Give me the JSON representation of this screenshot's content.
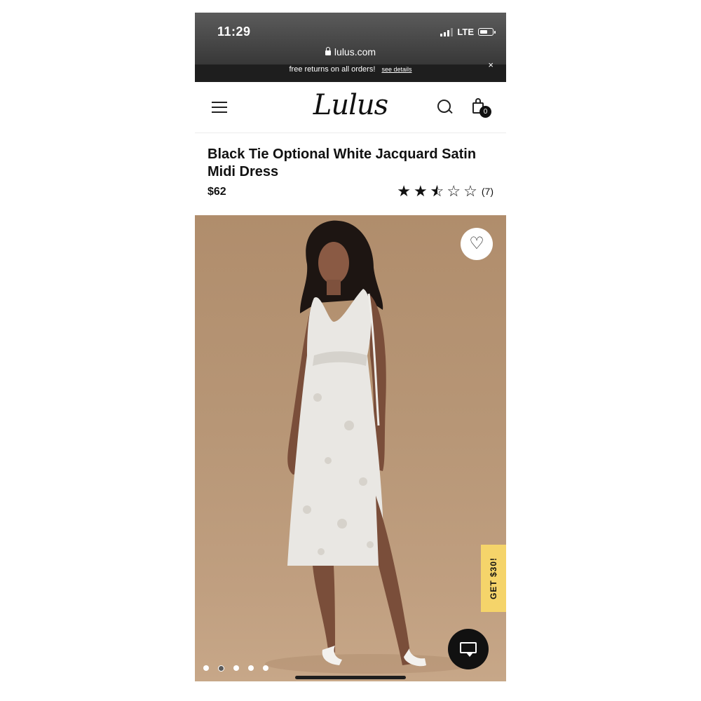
{
  "status_bar": {
    "time": "11:29",
    "network": "LTE"
  },
  "browser": {
    "url": "lulus.com"
  },
  "promo_banner": {
    "text": "free returns on all orders!",
    "details_link": "see details",
    "close": "×"
  },
  "header": {
    "logo": "Lulus",
    "cart_count": "0"
  },
  "product": {
    "title": "Black Tie Optional White Jacquard Satin Midi Dress",
    "price": "$62",
    "rating": 2.5,
    "rating_count": "(7)"
  },
  "hero": {
    "favorite_icon": "heart-icon",
    "side_tab": "GET $30!",
    "carousel_total": 5,
    "carousel_active": 2
  },
  "colors": {
    "accent_tab": "#f5d46a",
    "promo_bg": "#1e1e1e",
    "hero_bg": "#b79676"
  }
}
